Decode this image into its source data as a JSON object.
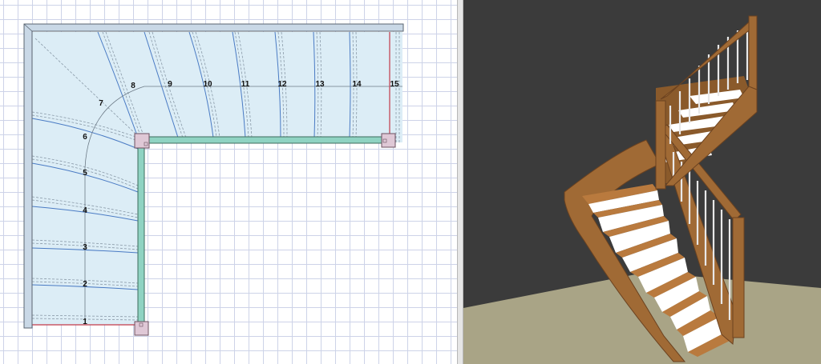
{
  "plan_view": {
    "step_numbers": [
      "1",
      "2",
      "3",
      "4",
      "5",
      "6",
      "7",
      "8",
      "9",
      "10",
      "11",
      "12",
      "13",
      "14",
      "15"
    ],
    "colors": {
      "grid": "#cdd3e8",
      "stair_fill": "#dcedf6",
      "wall": "#c9d8e6",
      "stringer": "#8fd3c2",
      "tread_line": "#4a7bc4",
      "post": "#dfc8d6",
      "red_edge": "#c23a4a"
    }
  },
  "view_3d": {
    "colors": {
      "background": "#3b3b3b",
      "floor": "#a9a486",
      "wood": "#a06a35",
      "riser": "#ffffff",
      "baluster": "#e8e8e8"
    }
  }
}
